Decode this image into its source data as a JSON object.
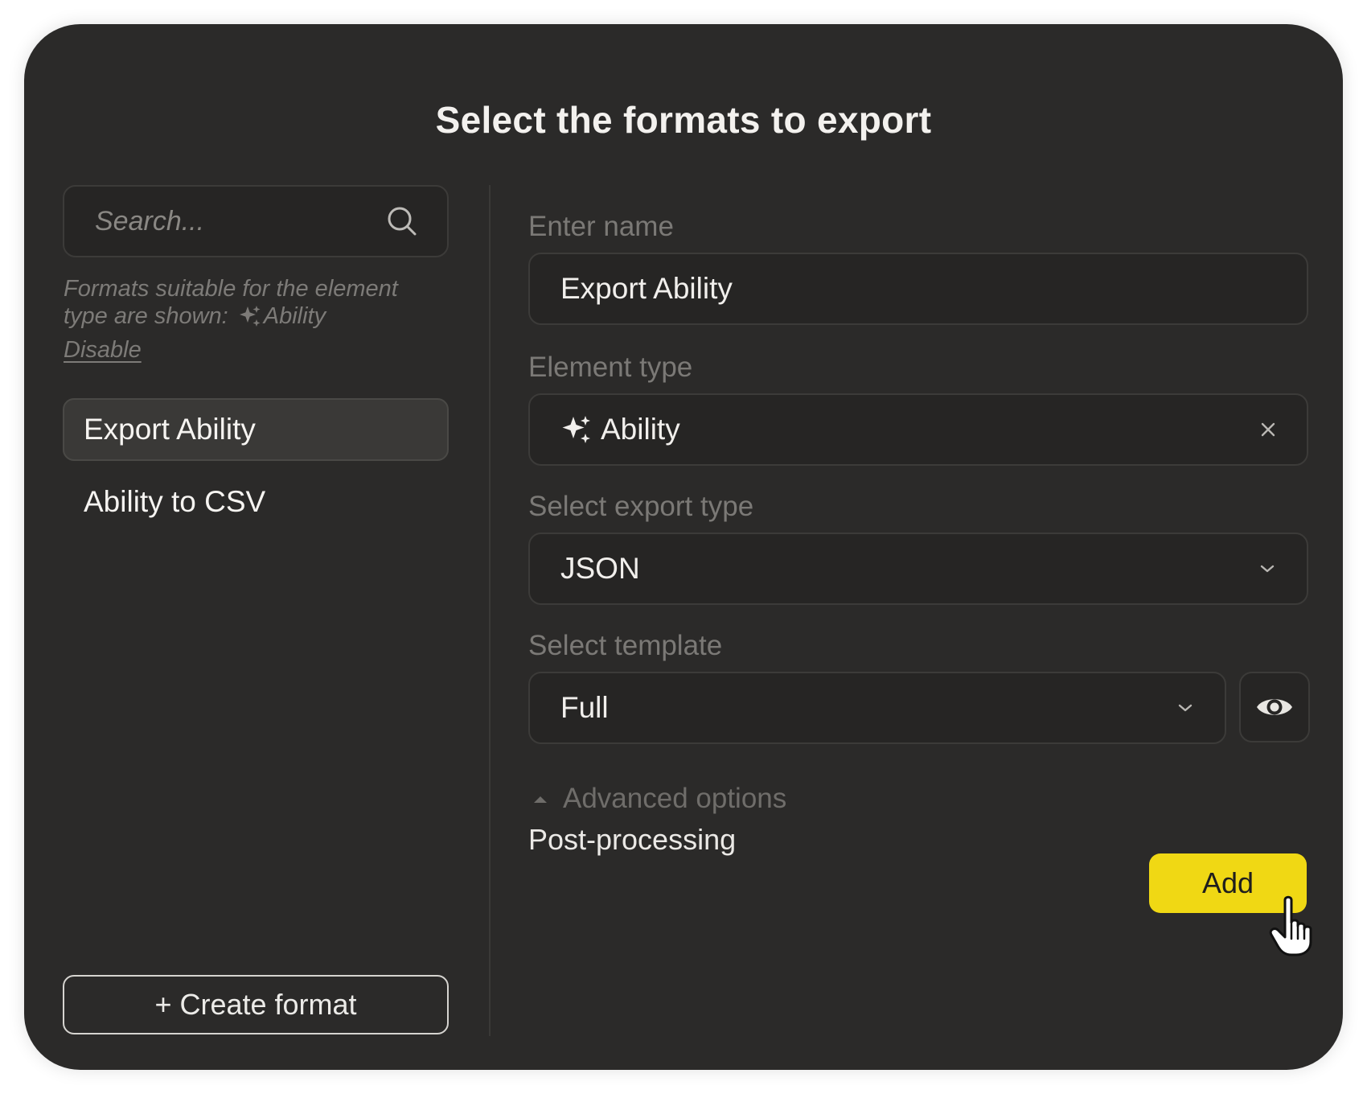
{
  "dialog": {
    "title": "Select the formats to export"
  },
  "sidebar": {
    "search": {
      "placeholder": "Search...",
      "icon": "search-icon"
    },
    "hint": {
      "text": "Formats suitable for the element type are shown:",
      "element_type": "Ability",
      "element_type_icon": "sparkles-icon",
      "disable_link": "Disable"
    },
    "formats": [
      {
        "label": "Export Ability",
        "selected": true
      },
      {
        "label": "Ability to CSV",
        "selected": false
      }
    ],
    "create_button": "+ Create format"
  },
  "form": {
    "name": {
      "label": "Enter name",
      "value": "Export Ability"
    },
    "element_type": {
      "label": "Element type",
      "value": "Ability",
      "icon": "sparkles-icon",
      "clear_icon": "close-icon"
    },
    "export_type": {
      "label": "Select export type",
      "value": "JSON",
      "icon": "chevron-down-icon"
    },
    "template": {
      "label": "Select template",
      "value": "Full",
      "icon": "chevron-down-icon",
      "preview_icon": "eye-icon"
    },
    "advanced": {
      "label": "Advanced options",
      "icon": "caret-up-icon",
      "expanded": true
    },
    "post_processing": {
      "label": "Post-processing",
      "button": "Add"
    }
  },
  "colors": {
    "dialog_bg": "#2b2a29",
    "field_bg": "#262524",
    "accent": "#f0d814",
    "text_primary": "#f1efec",
    "text_muted": "#7b7976"
  }
}
